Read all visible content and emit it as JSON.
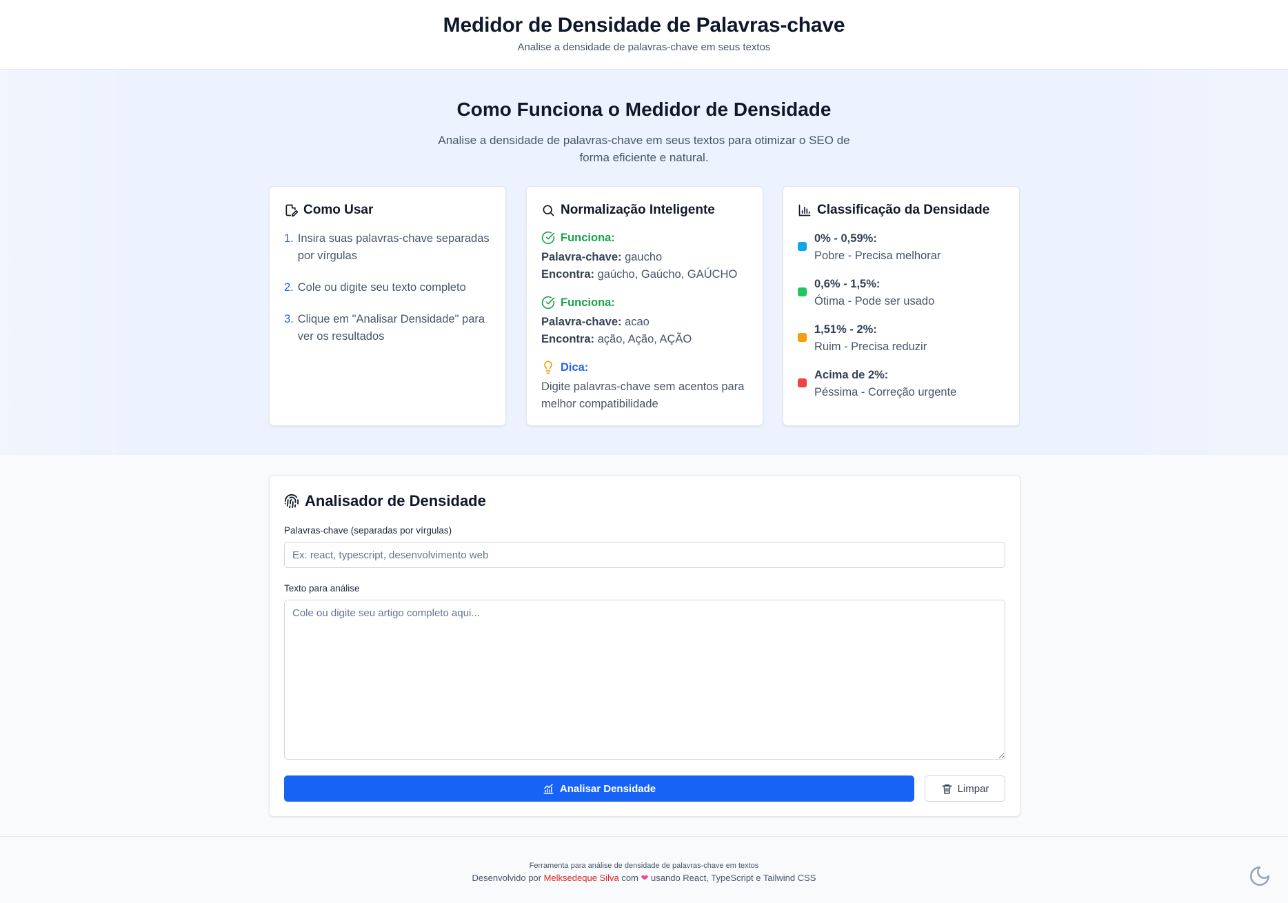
{
  "header": {
    "title": "Medidor de Densidade de Palavras-chave",
    "subtitle": "Analise a densidade de palavras-chave em seus textos"
  },
  "info": {
    "title": "Como Funciona o Medidor de Densidade",
    "description": "Analise a densidade de palavras-chave em seus textos para otimizar o SEO de forma eficiente e natural.",
    "how_to_use": {
      "title": "Como Usar",
      "icon": "edit-icon",
      "steps": [
        {
          "num": "1.",
          "text": "Insira suas palavras-chave separadas por vírgulas"
        },
        {
          "num": "2.",
          "text": "Cole ou digite seu texto completo"
        },
        {
          "num": "3.",
          "text": "Clique em \"Analisar Densidade\" para ver os resultados"
        }
      ]
    },
    "normalization": {
      "title": "Normalização Inteligente",
      "icon": "search-icon",
      "examples": [
        {
          "status": "Funciona:",
          "kw_label": "Palavra-chave:",
          "kw": " gaucho",
          "found_label": "Encontra:",
          "found": " gaúcho, Gaúcho, GAÚCHO"
        },
        {
          "status": "Funciona:",
          "kw_label": "Palavra-chave:",
          "kw": " acao",
          "found_label": "Encontra:",
          "found": " ação, Ação, AÇÃO"
        }
      ],
      "tip_label": "Dica:",
      "tip_text": "Digite palavras-chave sem acentos para melhor compatibilidade"
    },
    "classification": {
      "title": "Classificação da Densidade",
      "icon": "bar-chart-icon",
      "items": [
        {
          "range": "0% - 0,59%:",
          "label": "Pobre - Precisa melhorar",
          "color": "#0ea5e9"
        },
        {
          "range": "0,6% - 1,5%:",
          "label": "Ótima - Pode ser usado",
          "color": "#22c55e"
        },
        {
          "range": "1,51% - 2%:",
          "label": "Ruim - Precisa reduzir",
          "color": "#f59e0b"
        },
        {
          "range": "Acima de 2%:",
          "label": "Péssima - Correção urgente",
          "color": "#ef4444"
        }
      ]
    }
  },
  "analyzer": {
    "title": "Analisador de Densidade",
    "keywords_label": "Palavras-chave (separadas por vírgulas)",
    "keywords_placeholder": "Ex: react, typescript, desenvolvimento web",
    "keywords_value": "",
    "text_label": "Texto para análise",
    "text_placeholder": "Cole ou digite seu artigo completo aqui...",
    "text_value": "",
    "analyze_button": "Analisar Densidade",
    "clear_button": "Limpar"
  },
  "footer": {
    "line1": "Ferramenta para análise de densidade de palavras-chave em textos",
    "dev_prefix": "Desenvolvido por ",
    "author": "Melksedeque Silva",
    "with": " com ",
    "heart": "❤",
    "suffix": " usando React, TypeScript e Tailwind CSS"
  },
  "colors": {
    "accent": "#1763f5",
    "success": "#16a34a",
    "tip_icon": "#f59e0b"
  }
}
